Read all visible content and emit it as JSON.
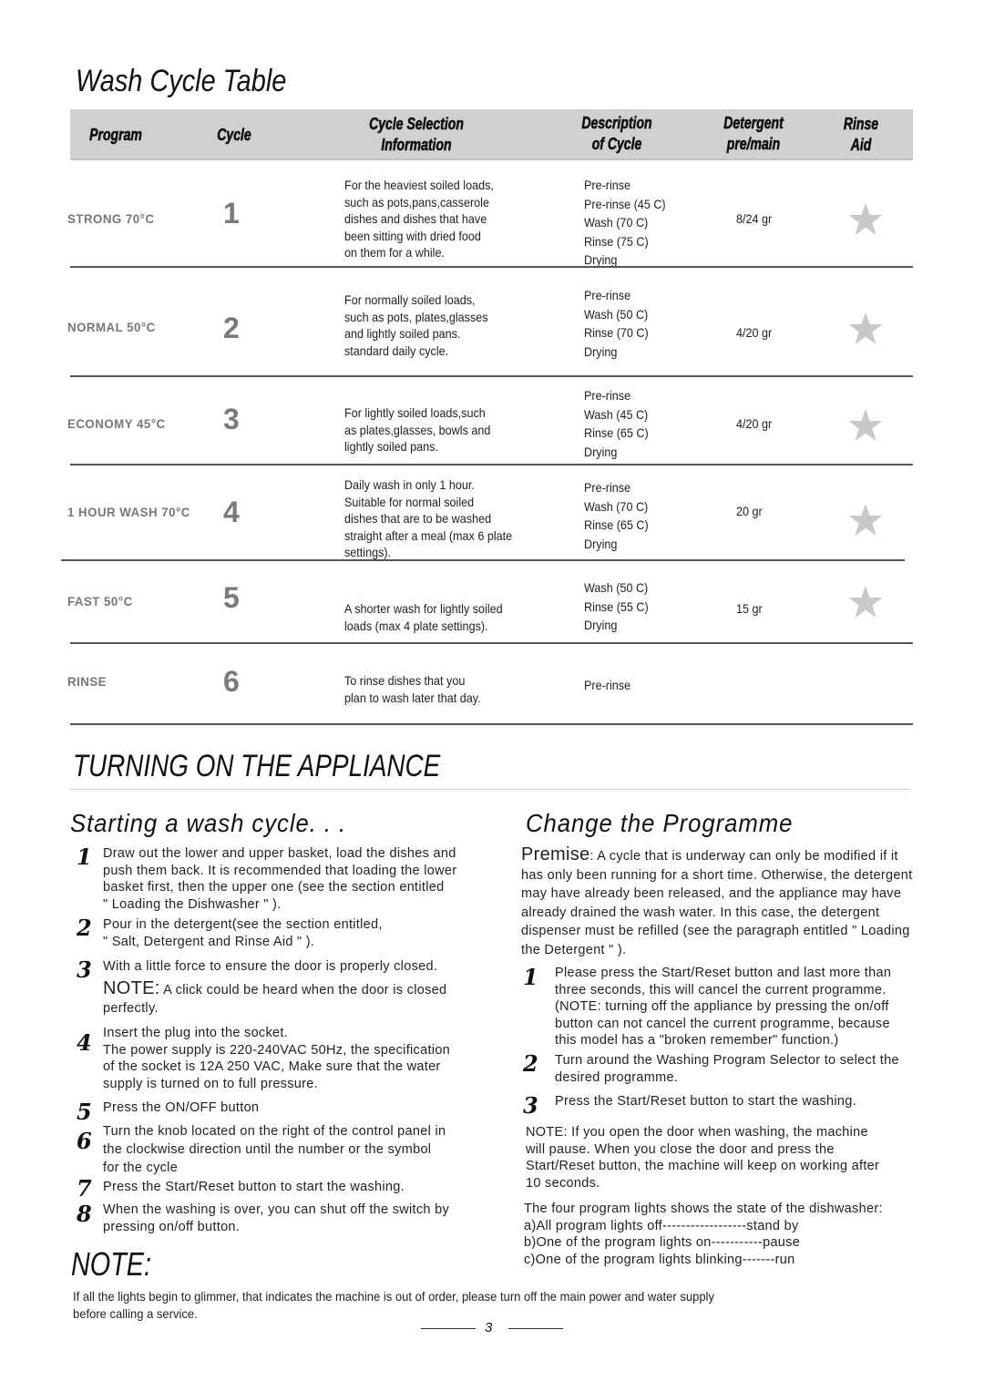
{
  "page_title": "Wash Cycle Table",
  "table": {
    "headers": {
      "program": "Program",
      "cycle": "Cycle",
      "cycle_selection_1": "Cycle Selection",
      "cycle_selection_2": "Information",
      "description_1": "Description",
      "description_2": "of Cycle",
      "detergent_1": "Detergent",
      "detergent_2": "pre/main",
      "rinse_aid_1": "Rinse",
      "rinse_aid_2": "Aid"
    },
    "rows": [
      {
        "program": "STRONG  70°C",
        "cycle": "1",
        "info": [
          "For the heaviest soiled loads,",
          "such as pots,pans,casserole",
          "dishes and dishes that have",
          "been sitting with dried food",
          "on them for a while."
        ],
        "description": [
          "Pre-rinse",
          "Pre-rinse (45  C)",
          "Wash (70  C)",
          "Rinse (75  C)",
          "Drying"
        ],
        "detergent": "8/24 gr",
        "rinse_aid": "star-icon"
      },
      {
        "program": "NORMAL  50°C",
        "cycle": "2",
        "info": [
          "For normally soiled loads,",
          "such as pots, plates,glasses",
          "and lightly soiled pans.",
          "standard daily cycle."
        ],
        "description": [
          "Pre-rinse",
          "Wash (50  C)",
          "Rinse (70  C)",
          "Drying"
        ],
        "detergent": "4/20 gr",
        "rinse_aid": "star-icon"
      },
      {
        "program": "ECONOMY  45°C",
        "cycle": "3",
        "info": [
          "For lightly soiled loads,such",
          "as plates,glasses, bowls and",
          "lightly soiled pans."
        ],
        "description": [
          "Pre-rinse",
          "Wash (45  C)",
          "Rinse (65  C)",
          "Drying"
        ],
        "detergent": "4/20 gr",
        "rinse_aid": "star-icon"
      },
      {
        "program": "1 HOUR WASH  70°C",
        "cycle": "4",
        "info": [
          "Daily wash in only 1 hour.",
          "Suitable for normal soiled",
          "dishes that are to be washed",
          "straight after a meal (max 6 plate",
          "settings)."
        ],
        "description": [
          "Pre-rinse",
          "Wash (70  C)",
          "Rinse (65  C)",
          "Drying"
        ],
        "detergent": "20 gr",
        "rinse_aid": "star-icon"
      },
      {
        "program": "FAST  50°C",
        "cycle": "5",
        "info": [
          "A shorter wash for lightly soiled",
          "loads (max 4 plate settings)."
        ],
        "description": [
          "Wash (50  C)",
          "Rinse (55  C)",
          "Drying"
        ],
        "detergent": "15 gr",
        "rinse_aid": "star-icon"
      },
      {
        "program": "RINSE",
        "cycle": "6",
        "info": [
          "To rinse dishes that you",
          "plan to wash later that day."
        ],
        "description": [
          "Pre-rinse"
        ],
        "detergent": "",
        "rinse_aid": ""
      }
    ]
  },
  "section_title": "TURNING ON THE APPLIANCE",
  "starting": {
    "title": "Starting a wash cycle. . .",
    "steps": [
      {
        "num": "1",
        "lines": [
          "Draw out the lower and upper basket, load the dishes and",
          "push them back. It is recommended that loading the lower",
          "basket first, then the upper one (see the section entitled",
          "\" Loading the Dishwasher \" )."
        ]
      },
      {
        "num": "2",
        "lines": [
          "Pour in the detergent(see the section entitled,",
          "\" Salt, Detergent and Rinse Aid \" )."
        ]
      },
      {
        "num": "3",
        "lines": [
          "With a little force to ensure the door is properly closed."
        ],
        "note_label": "NOTE:",
        "note_lines": [
          " A click  could be heard when the door is closed",
          "perfectly."
        ]
      },
      {
        "num": "4",
        "lines": [
          "Insert the plug into the socket.",
          "The power supply is 220-240VAC 50Hz, the specification",
          "of the socket is 12A 250 VAC, Make sure that the water",
          "supply is turned on to full pressure."
        ]
      },
      {
        "num": "5",
        "lines": [
          "Press the ON/OFF button"
        ]
      },
      {
        "num": "6",
        "lines": [
          "Turn the knob located on the right of the control panel in",
          "the clockwise direction until the number or the symbol",
          "for the cycle"
        ]
      },
      {
        "num": "7",
        "lines": [
          "Press the Start/Reset button to start the washing."
        ]
      },
      {
        "num": "8",
        "lines": [
          "When the washing is over, you can shut off the switch by",
          "pressing on/off button."
        ]
      }
    ]
  },
  "change": {
    "title": "Change the Programme",
    "premise_label": "Premise",
    "premise_lines": [
      ": A cycle that is underway can only be modified if it",
      "has only been running for a short time. Otherwise, the detergent",
      "may have already been released, and the appliance may have",
      "already drained the wash water. In this case, the detergent",
      "dispenser must be refilled (see the paragraph entitled \" Loading",
      "the Detergent \" )."
    ],
    "steps": [
      {
        "num": "1",
        "lines": [
          "Please press the Start/Reset button and last more than",
          "three seconds, this will cancel the current programme.",
          "(NOTE: turning off the appliance by pressing the on/off",
          "button can not cancel the current programme, because",
          "this model has a \"broken remember\" function.)"
        ]
      },
      {
        "num": "2",
        "lines": [
          "Turn around  the Washing Program Selector to select the",
          "desired programme."
        ]
      },
      {
        "num": "3",
        "lines": [
          "Press the Start/Reset  button to start the washing."
        ]
      }
    ],
    "note_lines": [
      "NOTE: If you open the door when washing, the machine",
      "will pause. When you close the door and press the",
      "Start/Reset button, the machine will keep on working after",
      "10 seconds."
    ],
    "lights_lines": [
      "The four program lights shows the state of the dishwasher:",
      "a)All program lights off------------------stand by",
      "b)One of the program lights on-----------pause",
      "c)One of the program lights blinking-------run"
    ]
  },
  "note": {
    "title": "NOTE:",
    "lines": [
      "If all the lights begin to glimmer, that indicates the machine is out of order, please turn off the main power and water supply",
      "before calling a service."
    ]
  },
  "page_number": "3",
  "colors": {
    "header_bg": "#d0d0d0",
    "program_text": "#777777",
    "star": "#c8c8c8"
  }
}
